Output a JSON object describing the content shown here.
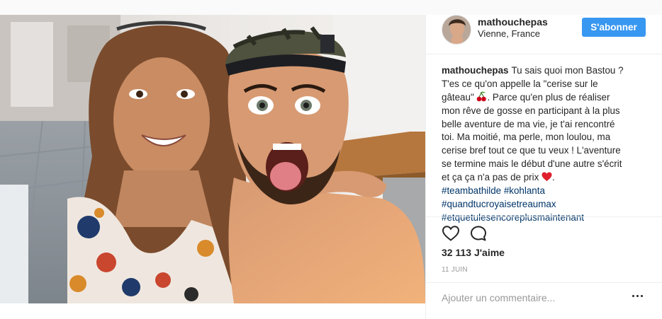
{
  "post": {
    "username": "mathouchepas",
    "location": "Vienne, France",
    "follow_label": "S'abonner",
    "caption_lines": [
      "Tu sais quoi mon Bastou ?",
      "T'es ce qu'on appelle la \"cerise sur le",
      "gâteau\"",
      ". Parce qu'en plus de réaliser",
      "mon rêve de gosse en participant à la plus",
      "belle aventure de ma vie, je t'ai rencontré",
      "toi. Ma moitié, ma perle, mon loulou, ma",
      "cerise bref tout ce que tu veux ! L'aventure",
      "se termine mais le début d'une autre s'écrit",
      "et ça ça n'a pas de prix",
      "."
    ],
    "hashtags": [
      "#teambathilde #kohlanta",
      "#quandtucroyaisetreaumax",
      "#etquetulesencoreplusmaintenant"
    ],
    "likes": "32 113 J'aime",
    "date": "11 JUIN",
    "comment_placeholder": "Ajouter un commentaire..."
  },
  "icons": {
    "like": "heart-icon",
    "comment": "comment-bubble-icon",
    "more": "more-options-icon",
    "emoji_1": "cherries-emoji",
    "emoji_2": "red-heart-emoji"
  },
  "colors": {
    "follow_button": "#3897f0",
    "hashtag": "#003569",
    "text": "#262626",
    "muted": "#999999"
  }
}
